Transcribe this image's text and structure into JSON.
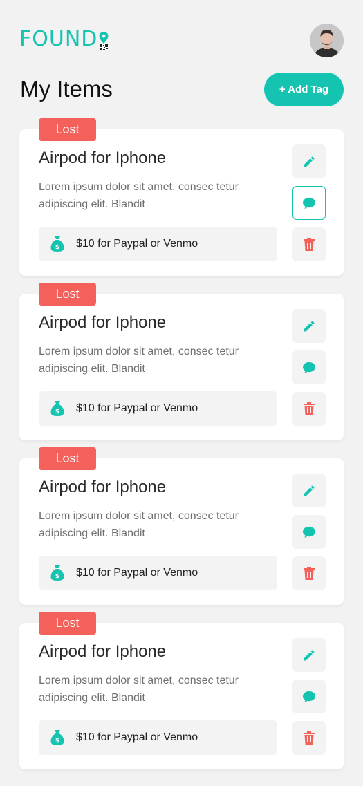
{
  "header": {
    "logo_text": "FOUND",
    "brand_color": "#14c4b0",
    "avatar_icon": "user-avatar-photo"
  },
  "page": {
    "title": "My Items",
    "add_tag_label": "+ Add Tag"
  },
  "colors": {
    "accent": "#14c4b0",
    "lost_badge": "#f4605a",
    "delete": "#f4605a"
  },
  "items": [
    {
      "status": "Lost",
      "title": "Airpod for Iphone",
      "description": "Lorem ipsum dolor sit amet, consec tetur adipiscing elit. Blandit",
      "reward": "$10 for Paypal or Venmo",
      "icons": [
        "pencil-icon",
        "chat-icon",
        "trash-icon",
        "money-bag-icon"
      ]
    },
    {
      "status": "Lost",
      "title": "Airpod for Iphone",
      "description": "Lorem ipsum dolor sit amet, consec tetur adipiscing elit. Blandit",
      "reward": "$10 for Paypal or Venmo",
      "icons": [
        "pencil-icon",
        "chat-icon",
        "trash-icon",
        "money-bag-icon"
      ]
    },
    {
      "status": "Lost",
      "title": "Airpod for Iphone",
      "description": "Lorem ipsum dolor sit amet, consec tetur adipiscing elit. Blandit",
      "reward": "$10 for Paypal or Venmo",
      "icons": [
        "pencil-icon",
        "chat-icon",
        "trash-icon",
        "money-bag-icon"
      ]
    },
    {
      "status": "Lost",
      "title": "Airpod for Iphone",
      "description": "Lorem ipsum dolor sit amet, consec tetur adipiscing elit. Blandit",
      "reward": "$10 for Paypal or Venmo",
      "icons": [
        "pencil-icon",
        "chat-icon",
        "trash-icon",
        "money-bag-icon"
      ]
    }
  ]
}
